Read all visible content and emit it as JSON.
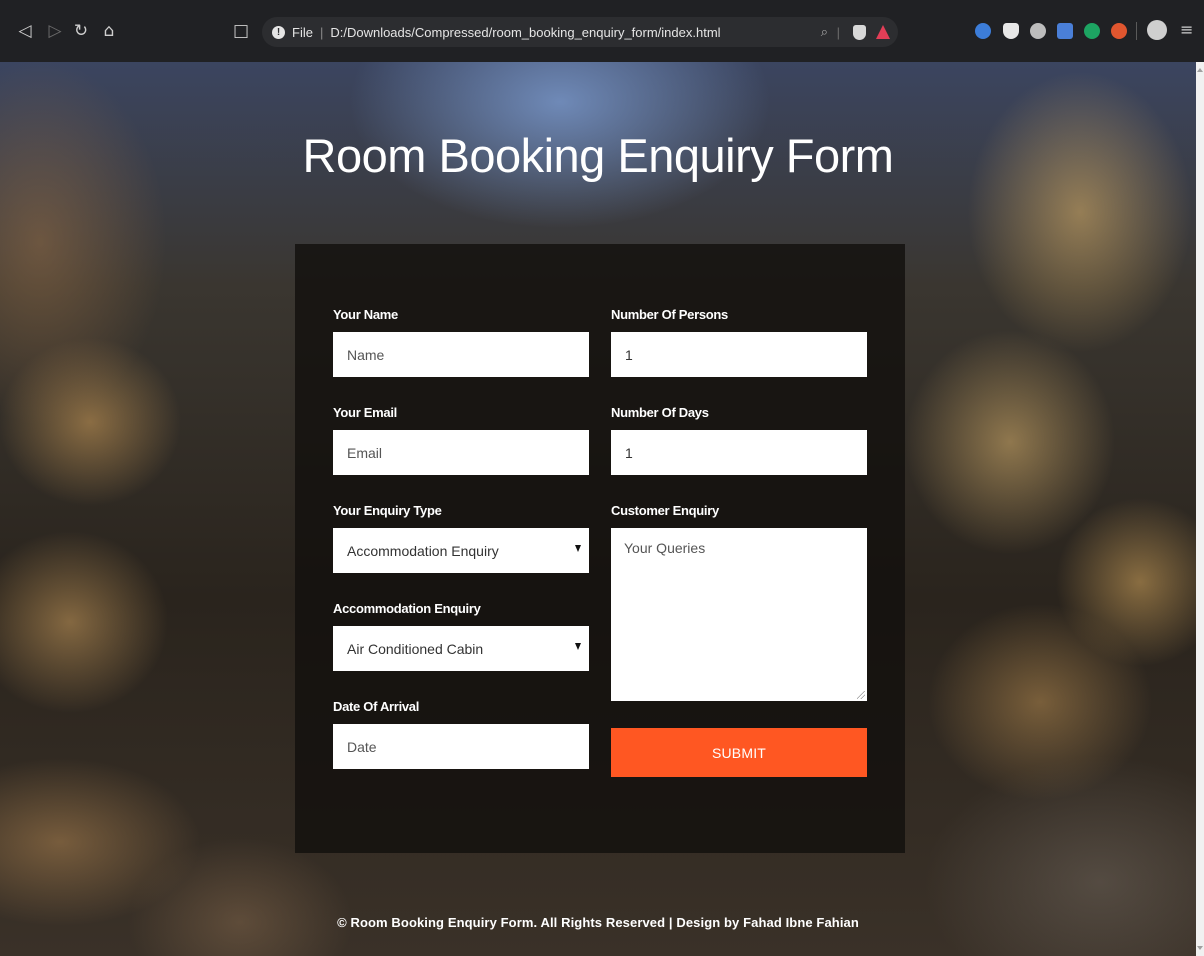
{
  "browser": {
    "url_scheme": "File",
    "url": "D:/Downloads/Compressed/room_booking_enquiry_form/index.html",
    "icons": [
      "back-icon",
      "forward-icon",
      "reload-icon",
      "home-icon",
      "bookmark-icon",
      "info-icon",
      "zoom-icon",
      "brave-shield-icon",
      "brave-rewards-icon",
      "extension-icons",
      "profile-icon",
      "menu-icon"
    ]
  },
  "page": {
    "title": "Room Booking Enquiry Form",
    "footer": "© Room Booking Enquiry Form. All Rights Reserved | Design by Fahad Ibne Fahian",
    "accent_color": "#ff5722"
  },
  "form": {
    "name": {
      "label": "Your Name",
      "placeholder": "Name"
    },
    "email": {
      "label": "Your Email",
      "placeholder": "Email"
    },
    "enquiry_type": {
      "label": "Your Enquiry Type",
      "selected": "Accommodation Enquiry"
    },
    "accommodation": {
      "label": "Accommodation Enquiry",
      "selected": "Air Conditioned Cabin"
    },
    "arrival": {
      "label": "Date Of Arrival",
      "placeholder": "Date"
    },
    "persons": {
      "label": "Number Of Persons",
      "value": "1"
    },
    "days": {
      "label": "Number Of Days",
      "value": "1"
    },
    "customer_enquiry": {
      "label": "Customer Enquiry",
      "placeholder": "Your Queries"
    },
    "submit_label": "SUBMIT"
  }
}
